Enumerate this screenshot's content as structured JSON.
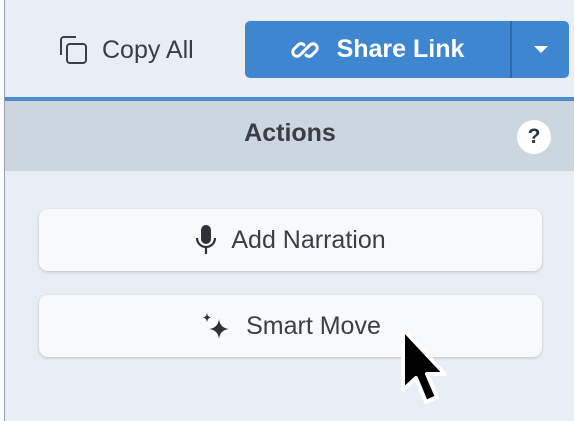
{
  "toolbar": {
    "copy_all_label": "Copy All",
    "share_link_label": "Share Link"
  },
  "panel": {
    "title": "Actions",
    "help_label": "?"
  },
  "actions": {
    "add_narration_label": "Add Narration",
    "smart_move_label": "Smart Move"
  },
  "icons": {
    "copy": "copy-icon",
    "link": "link-icon",
    "dropdown": "chevron-down-icon",
    "microphone": "microphone-icon",
    "sparkle": "sparkle-icon",
    "cursor": "mouse-pointer-icon"
  },
  "colors": {
    "accent": "#3e87d0",
    "panel_bg": "#e9eef4",
    "header_bg": "#ccd6de"
  }
}
